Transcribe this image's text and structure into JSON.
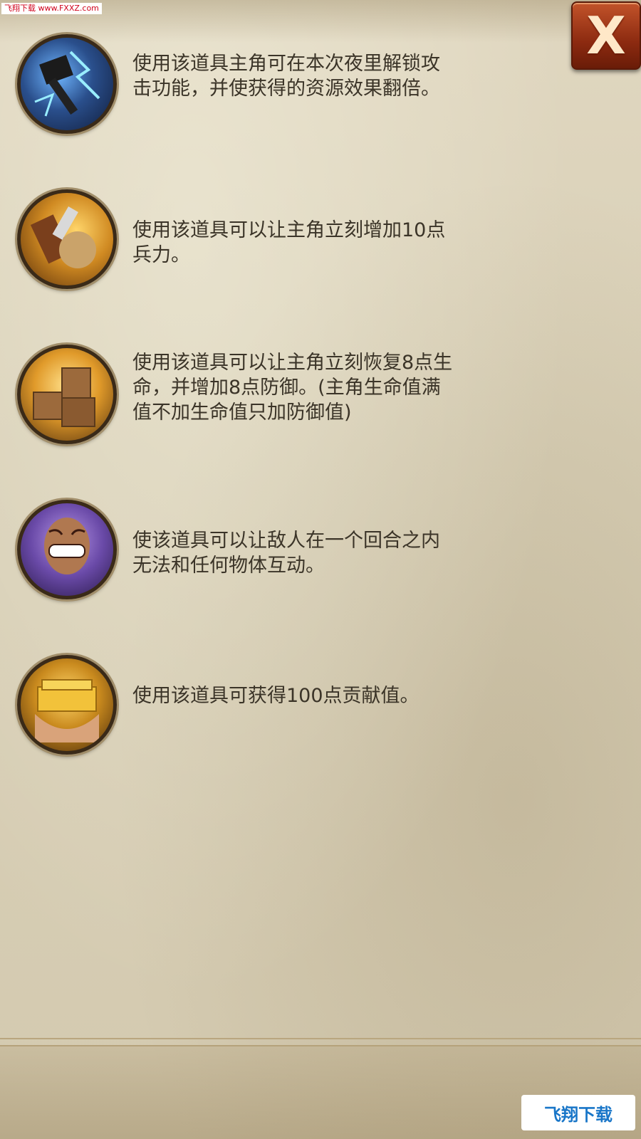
{
  "watermark_top": "飞翔下载 www.FXXZ.com",
  "close_button": {
    "label": "X"
  },
  "items": [
    {
      "icon": "hammer-lightning-icon",
      "text": "使用该道具主角可在本次夜里解锁攻击功能，并使获得的资源效果翻倍。"
    },
    {
      "icon": "fist-weapon-icon",
      "text": "使用该道具可以让主角立刻增加10点兵力。"
    },
    {
      "icon": "supply-crates-icon",
      "text": "使用该道具可以让主角立刻恢复8点生命，并增加8点防御。(主角生命值满值不加生命值只加防御值)"
    },
    {
      "icon": "grinning-face-icon",
      "text": "使该道具可以让敌人在一个回合之内无法和任何物体互动。"
    },
    {
      "icon": "gold-bars-hands-icon",
      "text": "使用该道具可获得100点贡献值。"
    }
  ],
  "watermark_bottom": "飞翔下载"
}
